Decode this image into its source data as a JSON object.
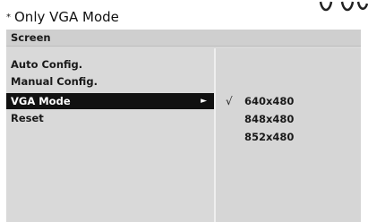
{
  "caption": {
    "marker": "*",
    "text": "Only VGA Mode"
  },
  "osd": {
    "title": "Screen",
    "menu_items": [
      {
        "label": "Auto Config.",
        "selected": false
      },
      {
        "label": "Manual Config.",
        "selected": false
      },
      {
        "label": "VGA Mode",
        "selected": true,
        "arrow": "►"
      },
      {
        "label": "Reset",
        "selected": false
      }
    ],
    "options": [
      {
        "label": "640x480",
        "checked": true,
        "check_mark": "√"
      },
      {
        "label": "848x480",
        "checked": false
      },
      {
        "label": "852x480",
        "checked": false
      }
    ]
  }
}
